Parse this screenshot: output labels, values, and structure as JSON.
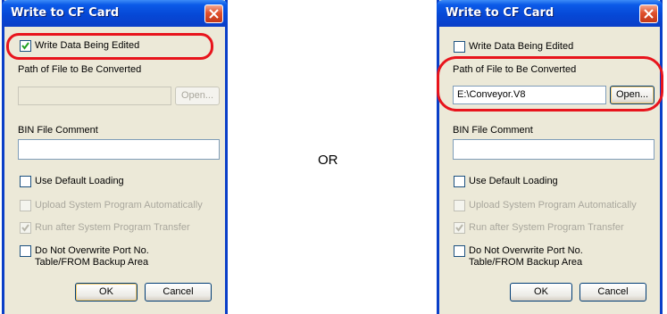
{
  "title": "Write to CF Card",
  "separator": "OR",
  "labels": {
    "write_data": "Write Data Being Edited",
    "path_label": "Path of File to Be Converted",
    "open_button": "Open...",
    "bin_comment": "BIN File Comment",
    "use_default": "Use Default Loading",
    "upload_system": "Upload System Program Automatically",
    "run_after": "Run after System Program Transfer",
    "no_overwrite_line1": "Do Not Overwrite Port No.",
    "no_overwrite_line2": "Table/FROM Backup Area",
    "ok": "OK",
    "cancel": "Cancel"
  },
  "dialog_left": {
    "write_data_checked": true,
    "path_value": "",
    "path_enabled": false,
    "highlight": "write-data-checkbox"
  },
  "dialog_right": {
    "write_data_checked": false,
    "path_value": "E:\\Conveyor.V8",
    "path_enabled": true,
    "highlight": "path-field"
  },
  "colors": {
    "highlight": "#e8141c",
    "title_bar": "#0648d6",
    "dialog_bg": "#ece9d8"
  }
}
